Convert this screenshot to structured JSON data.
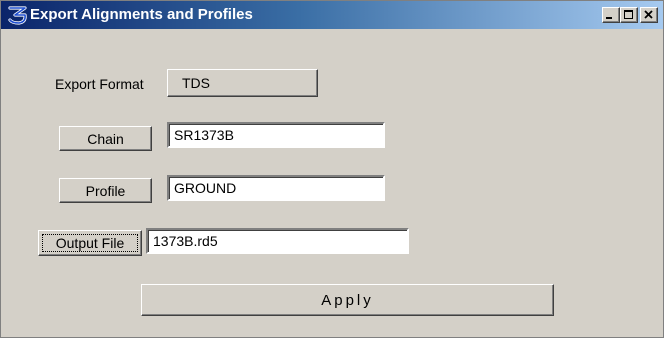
{
  "window": {
    "title": "Export Alignments and Profiles",
    "controls": [
      "minimize-icon",
      "maximize-icon",
      "close-icon"
    ]
  },
  "export_format": {
    "label": "Export Format",
    "value": "TDS"
  },
  "chain": {
    "button_label": "Chain",
    "value": "SR1373B"
  },
  "profile": {
    "button_label": "Profile",
    "value": "GROUND"
  },
  "output_file": {
    "button_label": "Output File",
    "value": "1373B.rd5"
  },
  "apply": {
    "label": "Apply"
  },
  "colors": {
    "dialog_bg": "#d4d0c8",
    "title_gradient_start": "#0a246a",
    "title_gradient_end": "#a6caf0",
    "title_text": "#ffffff"
  }
}
